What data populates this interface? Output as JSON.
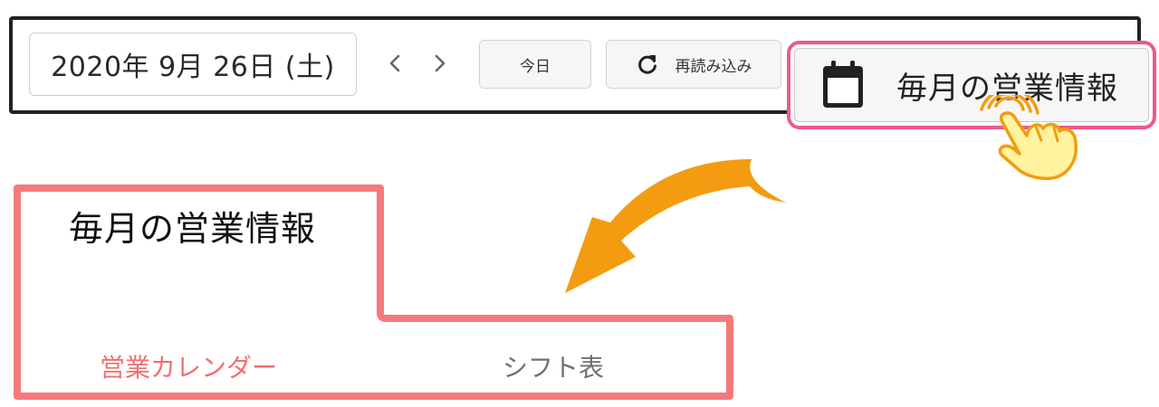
{
  "toolbar": {
    "date": "2020年 9月 26日 (土)",
    "today_label": "今日",
    "reload_label": "再読み込み",
    "monthly_label": "毎月の営業情報"
  },
  "panel": {
    "title": "毎月の営業情報",
    "tabs": [
      {
        "label": "営業カレンダー",
        "active": true
      },
      {
        "label": "シフト表",
        "active": false
      }
    ]
  },
  "colors": {
    "highlight": "#ec5a87",
    "annotation": "#f47a7a",
    "arrow": "#f39c12",
    "tab_active": "#f07070",
    "hand": "#fff3a0"
  },
  "icons": {
    "prev": "chevron-left-icon",
    "next": "chevron-right-icon",
    "reload": "refresh-icon",
    "calendar": "calendar-icon",
    "pointer": "pointing-hand-icon"
  }
}
